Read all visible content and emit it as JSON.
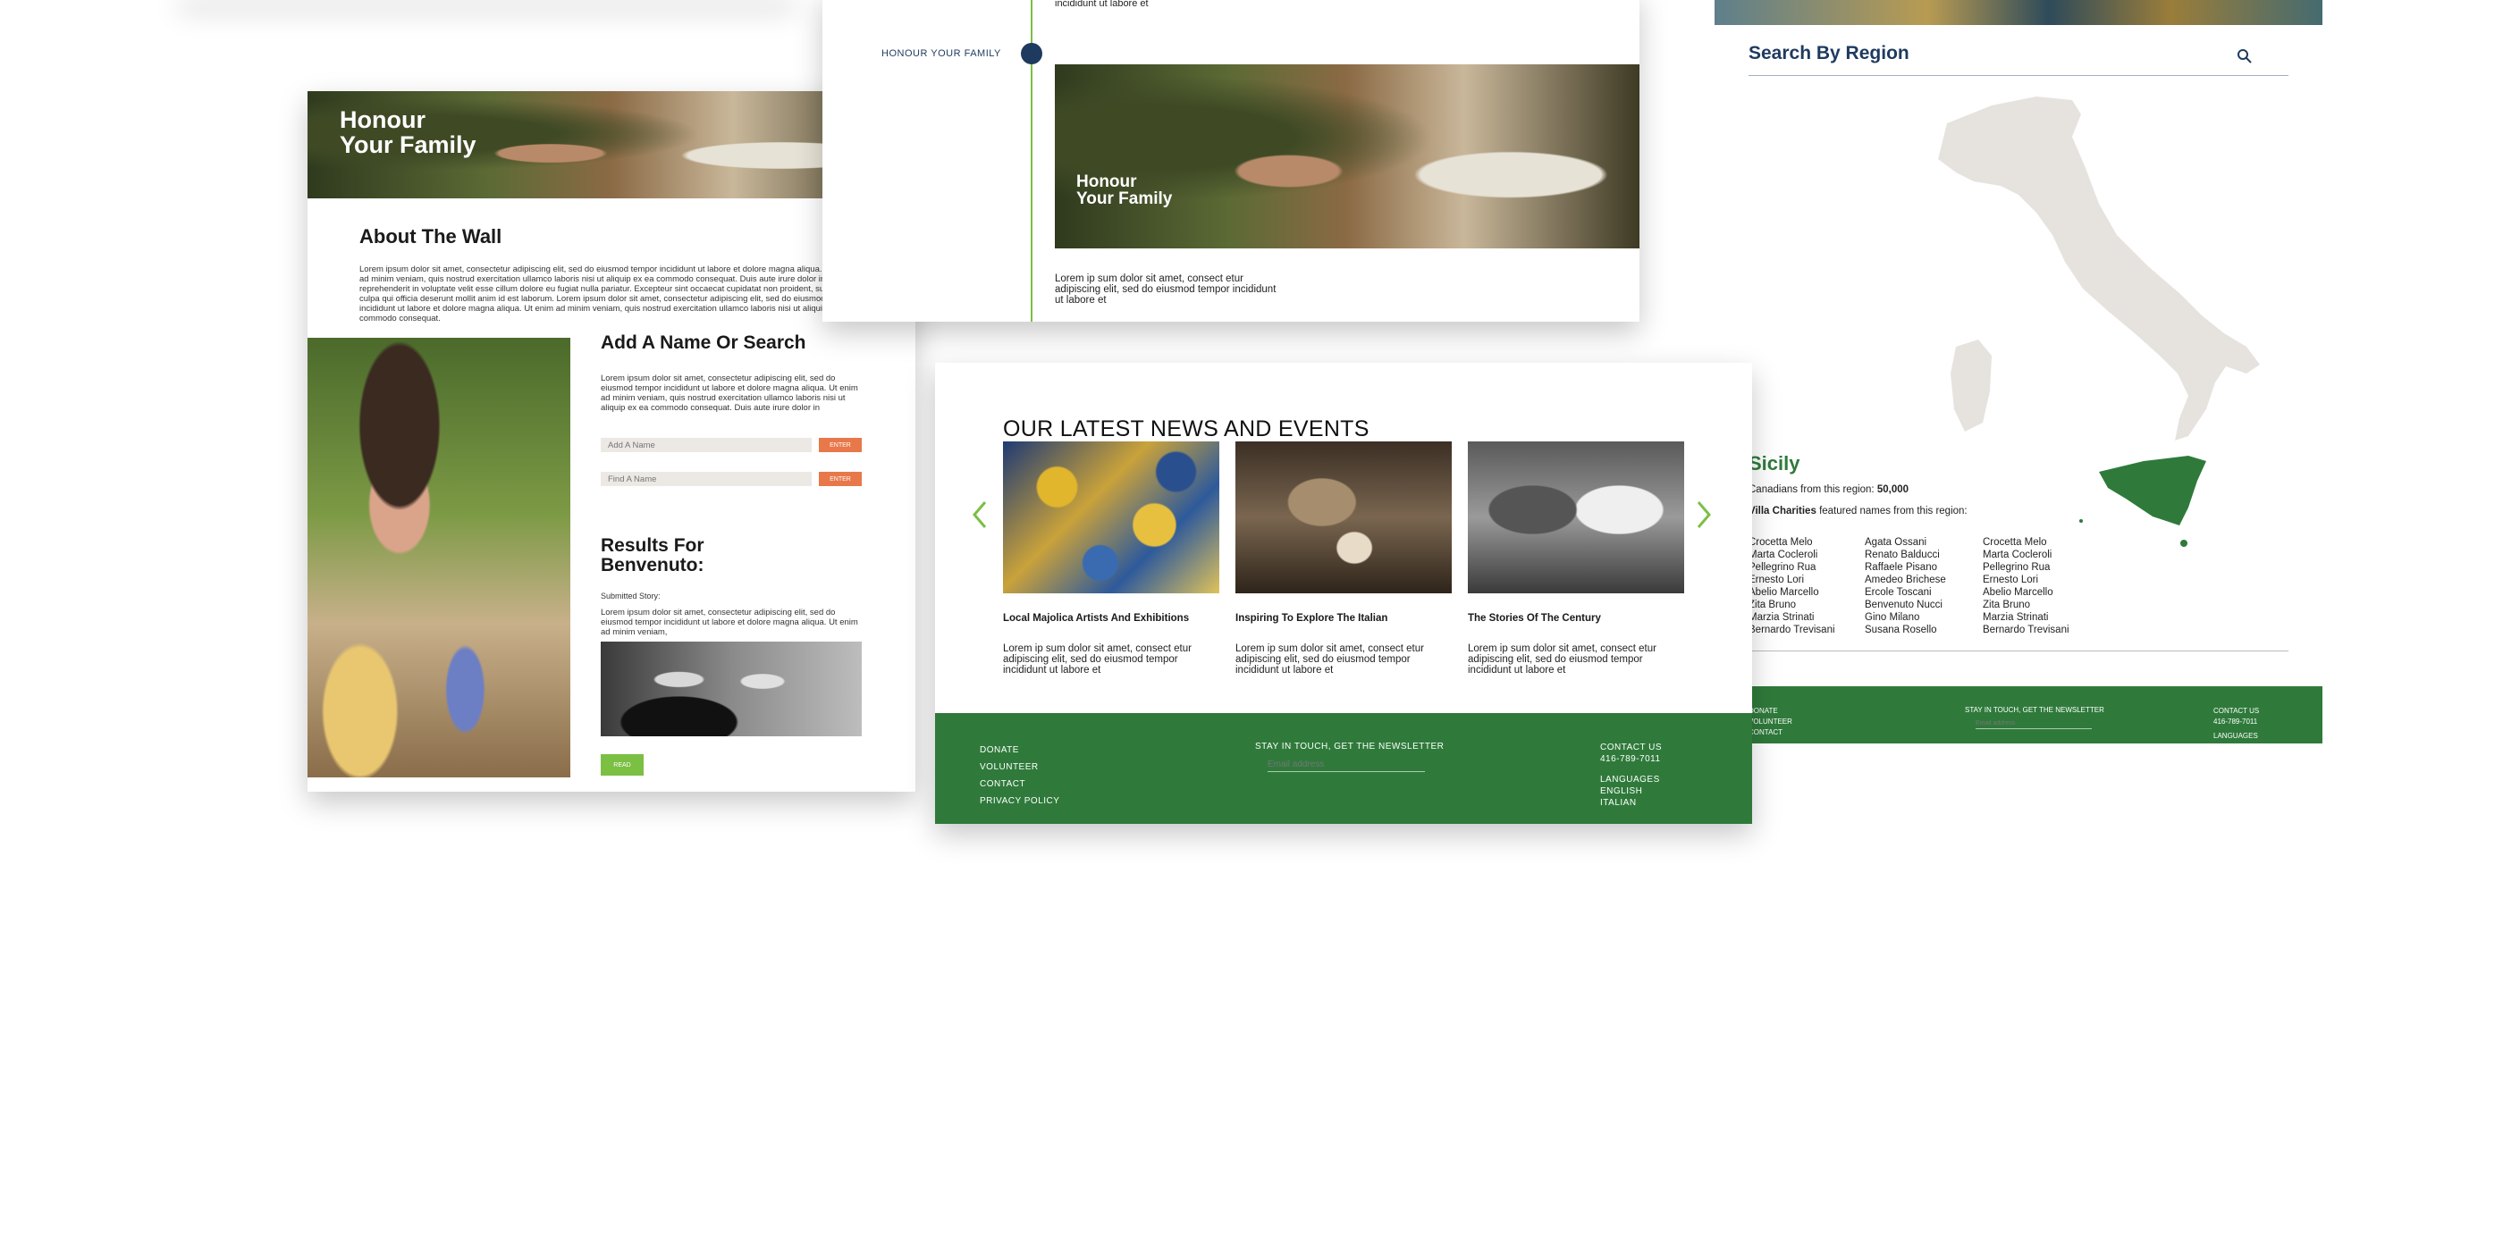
{
  "wall_page": {
    "hero_title_line1": "Honour",
    "hero_title_line2": "Your Family",
    "about_title": "About The Wall",
    "about_text": "Lorem ipsum dolor sit amet, consectetur adipiscing elit, sed do eiusmod tempor incididunt ut labore et dolore magna aliqua. Ut enim ad minim veniam, quis nostrud exercitation ullamco laboris nisi ut aliquip ex ea commodo consequat. Duis aute irure dolor in reprehenderit in voluptate velit esse cillum dolore eu fugiat nulla pariatur. Excepteur sint occaecat cupidatat non proident, sunt in culpa qui officia deserunt mollit anim id est laborum. Lorem ipsum dolor sit amet, consectetur adipiscing elit, sed do eiusmod tempor incididunt ut labore et dolore magna aliqua. Ut enim ad minim veniam, quis nostrud exercitation ullamco laboris nisi ut aliquip ex ea commodo consequat.",
    "add_title": "Add A Name Or Search",
    "add_text": "Lorem ipsum dolor sit amet, consectetur adipiscing elit, sed do eiusmod tempor incididunt ut labore et dolore magna aliqua. Ut enim ad minim veniam, quis nostrud exercitation ullamco laboris nisi ut aliquip ex ea commodo consequat. Duis aute irure dolor in",
    "add_placeholder": "Add A Name",
    "find_placeholder": "Find A Name",
    "enter_label": "ENTER",
    "results_title_line1": "Results For",
    "results_title_line2": "Benvenuto:",
    "submitted_label": "Submitted Story:",
    "story_text": "Lorem ipsum dolor sit amet, consectetur adipiscing elit, sed do eiusmod tempor incididunt ut labore et dolore magna aliqua. Ut enim ad minim veniam,",
    "read_label": "READ"
  },
  "timeline_page": {
    "top_text": "incididunt ut labore et",
    "timeline_label": "HONOUR YOUR FAMILY",
    "image_title_line1": "Honour",
    "image_title_line2": "Your Family",
    "body_text": "Lorem ip sum dolor sit amet, consect etur adipiscing elit, sed do eiusmod tempor incididunt ut labore et"
  },
  "news_page": {
    "title": "OUR LATEST NEWS AND EVENTS",
    "prev_icon": "chevron-left-icon",
    "next_icon": "chevron-right-icon",
    "items": [
      {
        "title": "Local Majolica Artists And Exhibitions",
        "text": "Lorem ip sum dolor sit amet, consect etur adipiscing elit, sed do eiusmod tempor incididunt ut labore et"
      },
      {
        "title": "Inspiring To Explore The Italian",
        "text": "Lorem ip sum dolor sit amet, consect etur adipiscing elit, sed do eiusmod tempor incididunt ut labore et"
      },
      {
        "title": "The Stories Of The Century",
        "text": "Lorem ip sum dolor sit amet, consect etur adipiscing elit, sed do eiusmod tempor incididunt ut labore et"
      }
    ],
    "footer": {
      "links": [
        "DONATE",
        "VOLUNTEER",
        "CONTACT",
        "PRIVACY POLICY"
      ],
      "newsletter_title": "STAY IN TOUCH, GET THE NEWSLETTER",
      "email_placeholder": "Email address",
      "contact_title": "CONTACT US",
      "phone": "416-789-7011",
      "languages_title": "LANGUAGES",
      "languages": [
        "ENGLISH",
        "ITALIAN"
      ]
    }
  },
  "region_page": {
    "search_title": "Search By Region",
    "search_icon": "search-icon",
    "region_name": "Sicily",
    "canadians_label": "Canadians from this region:",
    "canadians_count": "50,000",
    "featured_brand": "Villa Charities",
    "featured_text": "featured names from this region:",
    "name_columns": [
      [
        "Crocetta Melo",
        "Marta Cocleroli",
        "Pellegrino Rua",
        "Ernesto Lori",
        "Abelio Marcello",
        "Zita Bruno",
        "Marzia Strinati",
        "Bernardo Trevisani"
      ],
      [
        "Agata Ossani",
        "Renato Balducci",
        "Raffaele Pisano",
        "Amedeo Brichese",
        "Ercole Toscani",
        "Benvenuto Nucci",
        "Gino Milano",
        "Susana Rosello"
      ],
      [
        "Crocetta Melo",
        "Marta Cocleroli",
        "Pellegrino Rua",
        "Ernesto Lori",
        "Abelio Marcello",
        "Zita Bruno",
        "Marzia Strinati",
        "Bernardo Trevisani"
      ]
    ],
    "footer": {
      "links": [
        "DONATE",
        "VOLUNTEER",
        "CONTACT"
      ],
      "newsletter_title": "STAY IN TOUCH, GET THE NEWSLETTER",
      "email_placeholder": "Email address",
      "contact_title": "CONTACT US",
      "phone": "416-789-7011",
      "languages_title": "LANGUAGES"
    },
    "map_land_color": "#e6e3df",
    "map_highlight_color": "#2f7a3b"
  }
}
